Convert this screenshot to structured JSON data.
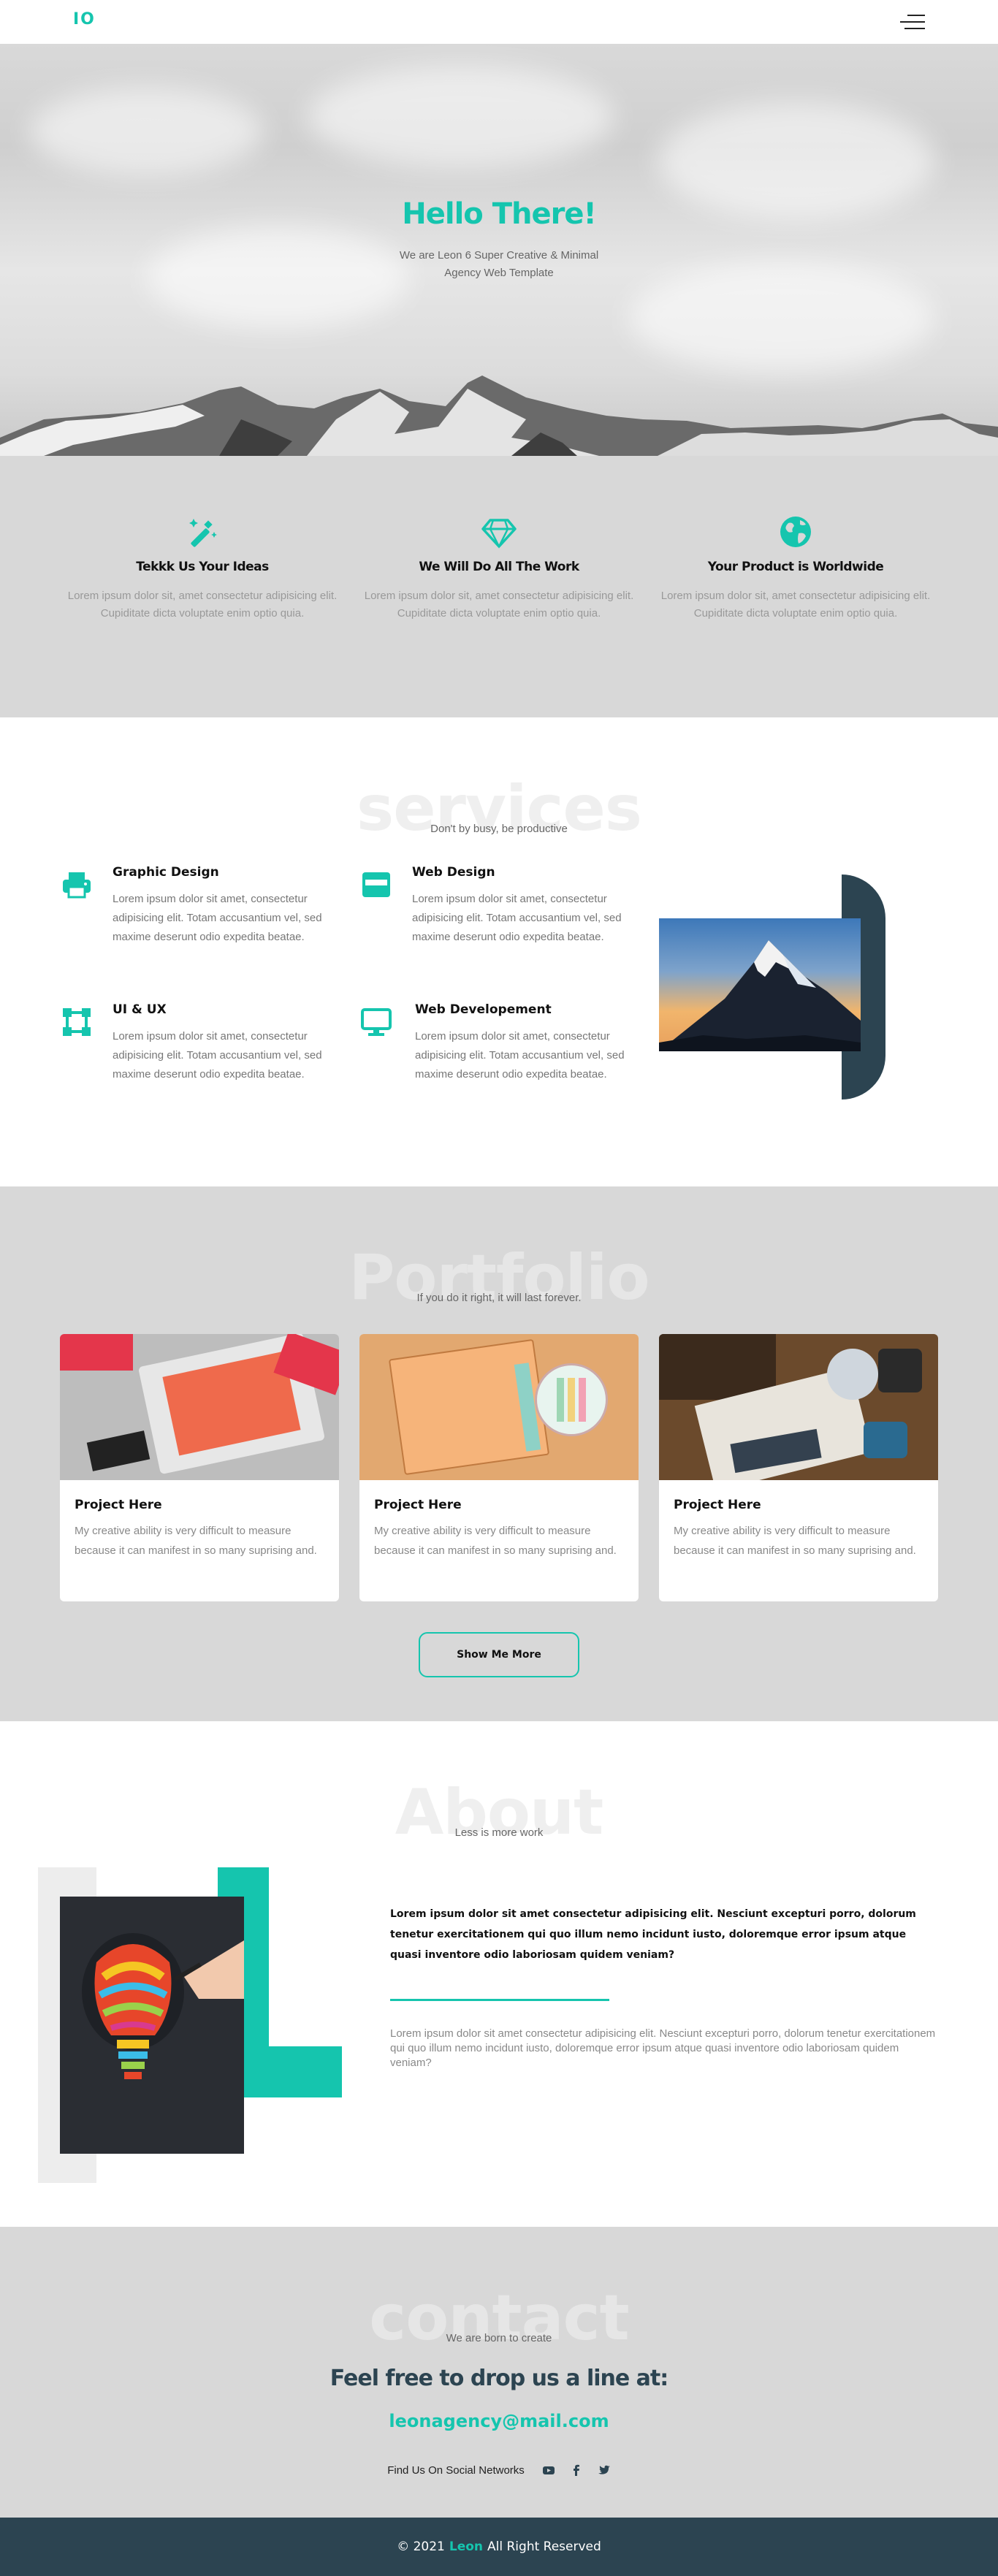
{
  "nav": {
    "logo": "IO",
    "menu_icon": "hamburger-menu-icon"
  },
  "hero": {
    "title": "Hello There!",
    "subtitle": "We are Leon 6 Super Creative & Minimal Agency Web Template"
  },
  "features": [
    {
      "icon": "magic-wand-icon",
      "title": "Tekkk Us Your Ideas",
      "text": "Lorem ipsum dolor sit, amet consectetur adipisicing elit. Cupiditate dicta voluptate enim optio quia."
    },
    {
      "icon": "diamond-icon",
      "title": "We Will Do All The Work",
      "text": "Lorem ipsum dolor sit, amet consectetur adipisicing elit. Cupiditate dicta voluptate enim optio quia."
    },
    {
      "icon": "globe-icon",
      "title": "Your Product is Worldwide",
      "text": "Lorem ipsum dolor sit, amet consectetur adipisicing elit. Cupiditate dicta voluptate enim optio quia."
    }
  ],
  "services": {
    "heading": "services",
    "tagline": "Don't by busy, be productive",
    "items": [
      {
        "icon": "printer-icon",
        "title": "Graphic Design",
        "text": "Lorem ipsum dolor sit amet, consectetur adipisicing elit. Totam accusantium vel, sed maxime deserunt odio expedita beatae."
      },
      {
        "icon": "browser-window-icon",
        "title": "Web Design",
        "text": "Lorem ipsum dolor sit amet, consectetur adipisicing elit. Totam accusantium vel, sed maxime deserunt odio expedita beatae."
      },
      {
        "icon": "vector-square-icon",
        "title": "UI & UX",
        "text": "Lorem ipsum dolor sit amet, consectetur adipisicing elit. Totam accusantium vel, sed maxime deserunt odio expedita beatae."
      },
      {
        "icon": "desktop-monitor-icon",
        "title": "Web Developement",
        "text": "Lorem ipsum dolor sit amet, consectetur adipisicing elit. Totam accusantium vel, sed maxime deserunt odio expedita beatae."
      }
    ]
  },
  "portfolio": {
    "heading": "Portfolio",
    "tagline": "If you do it right, it will last forever.",
    "projects": [
      {
        "title": "Project Here",
        "text": "My creative ability is very difficult to measure because it can manifest in so many suprising and."
      },
      {
        "title": "Project Here",
        "text": "My creative ability is very difficult to measure because it can manifest in so many suprising and."
      },
      {
        "title": "Project Here",
        "text": "My creative ability is very difficult to measure because it can manifest in so many suprising and."
      }
    ],
    "more_button": "Show Me More"
  },
  "about": {
    "heading": "About",
    "tagline": "Less is more work",
    "bold_text": "Lorem ipsum dolor sit amet consectetur adipisicing elit. Nesciunt excepturi porro, dolorum tenetur exercitationem qui quo illum nemo incidunt iusto, doloremque error ipsum atque quasi inventore odio laboriosam quidem veniam?",
    "light_text": "Lorem ipsum dolor sit amet consectetur adipisicing elit. Nesciunt excepturi porro, dolorum tenetur exercitationem qui quo illum nemo incidunt iusto, doloremque error ipsum atque quasi inventore odio laboriosam quidem veniam?"
  },
  "contact": {
    "heading": "contact",
    "tagline": "We are born to create",
    "title": "Feel free to drop us a line at:",
    "email": "leonagency@mail.com",
    "social_label": "Find Us On Social Networks",
    "social_icons": [
      "youtube-icon",
      "facebook-icon",
      "twitter-icon"
    ]
  },
  "footer": {
    "prefix": "© 2021",
    "brand": "Leon",
    "suffix": "All Right Reserved"
  },
  "colors": {
    "accent": "#15c5ae",
    "dark": "#2c4451",
    "grey_bg": "#d8d8d8"
  }
}
